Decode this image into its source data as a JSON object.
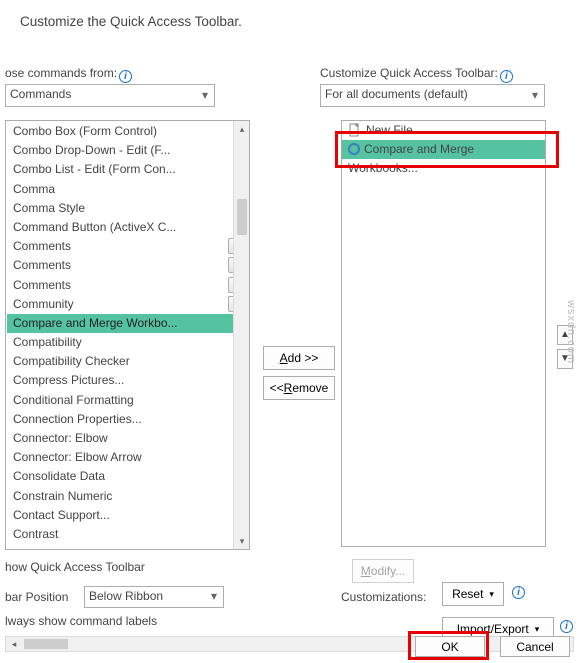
{
  "title": "Customize the Quick Access Toolbar.",
  "chooseFrom": {
    "label": "ose commands from:",
    "value": "Commands"
  },
  "customizeQAT": {
    "label": "Customize Quick Access Toolbar:",
    "value": "For all documents (default)"
  },
  "leftList": [
    {
      "label": "Combo Box (Form Control)",
      "type": "plain"
    },
    {
      "label": "Combo Drop-Down - Edit (F...",
      "type": "plain"
    },
    {
      "label": "Combo List - Edit (Form Con...",
      "type": "plain"
    },
    {
      "label": "Comma",
      "type": "plain"
    },
    {
      "label": "Comma Style",
      "type": "plain"
    },
    {
      "label": "Command Button (ActiveX C...",
      "type": "plain"
    },
    {
      "label": "Comments",
      "type": "dd"
    },
    {
      "label": "Comments",
      "type": "dd"
    },
    {
      "label": "Comments",
      "type": "dd"
    },
    {
      "label": "Community",
      "type": "dd"
    },
    {
      "label": "Compare and Merge Workbo...",
      "type": "plain",
      "selected": true
    },
    {
      "label": "Compatibility",
      "type": "sub"
    },
    {
      "label": "Compatibility Checker",
      "type": "plain"
    },
    {
      "label": "Compress Pictures...",
      "type": "plain"
    },
    {
      "label": "Conditional Formatting",
      "type": "sub"
    },
    {
      "label": "Connection Properties...",
      "type": "plain"
    },
    {
      "label": "Connector: Elbow",
      "type": "plain"
    },
    {
      "label": "Connector: Elbow Arrow",
      "type": "plain"
    },
    {
      "label": "Consolidate Data",
      "type": "plain"
    },
    {
      "label": "Constrain Numeric",
      "type": "plain"
    },
    {
      "label": "Contact Support...",
      "type": "plain"
    },
    {
      "label": "Contrast",
      "type": "sub"
    }
  ],
  "rightList": [
    {
      "icon": "doc",
      "label": "New File"
    },
    {
      "icon": "ring",
      "label": "Compare and Merge Workbooks...",
      "selected": true
    }
  ],
  "buttons": {
    "add": "Add >>",
    "remove": "<< Remove",
    "modify": "Modify...",
    "reset": "Reset",
    "impexp": "Import/Export",
    "ok": "OK",
    "cancel": "Cancel"
  },
  "showToolbar": "how Quick Access Toolbar",
  "toolbarPosition": {
    "label": "bar Position",
    "value": "Below Ribbon"
  },
  "alwaysShow": "lways show command labels",
  "customizationsLabel": "Customizations:",
  "watermark": "wsxdn.com"
}
